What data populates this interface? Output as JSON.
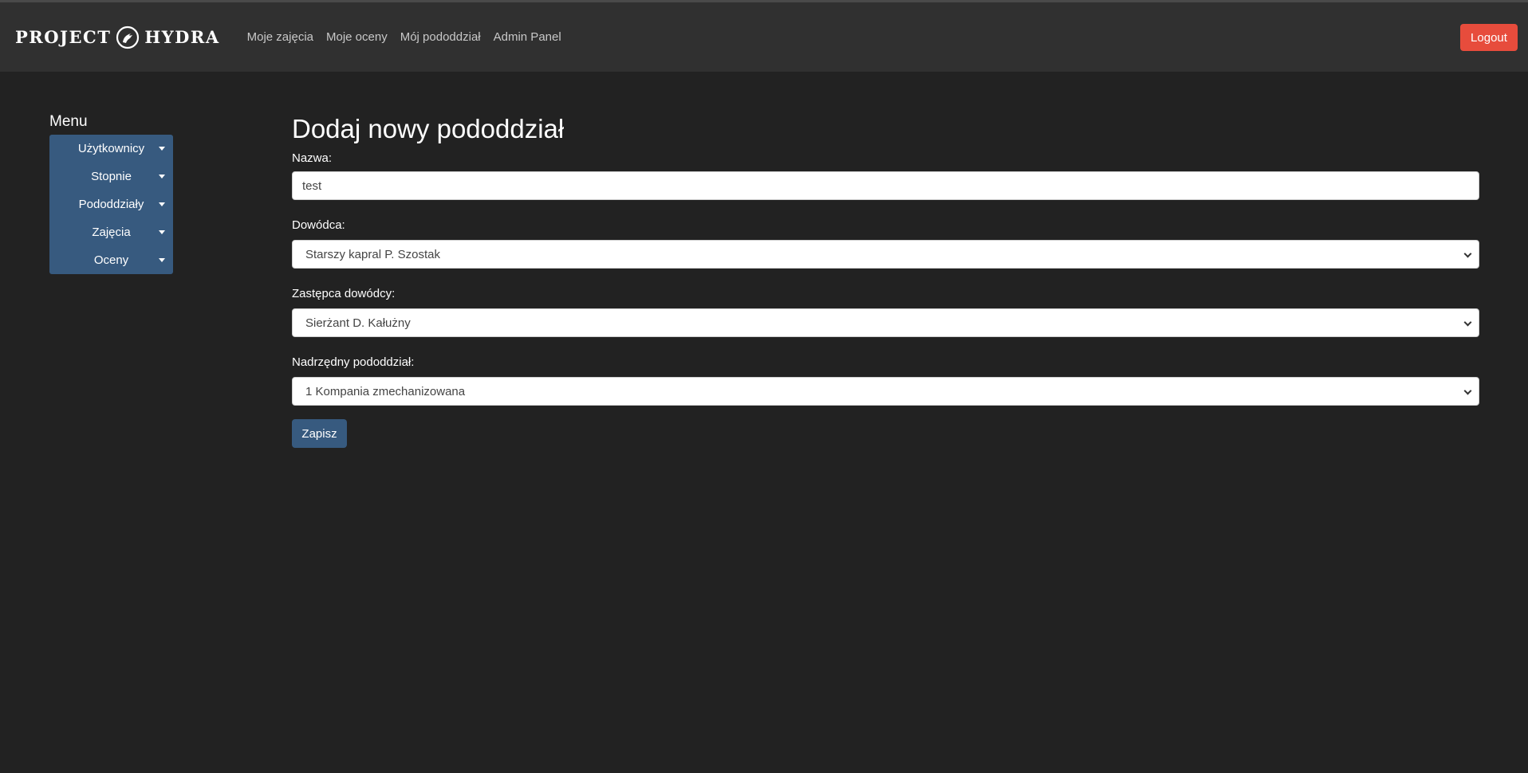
{
  "navbar": {
    "brand_left": "PROJECT",
    "brand_right": "HYDRA",
    "links": [
      "Moje zajęcia",
      "Moje oceny",
      "Mój pododdział",
      "Admin Panel"
    ],
    "logout_label": "Logout"
  },
  "sidebar": {
    "title": "Menu",
    "items": [
      {
        "label": "Użytkownicy"
      },
      {
        "label": "Stopnie"
      },
      {
        "label": "Pododdziały"
      },
      {
        "label": "Zajęcia"
      },
      {
        "label": "Oceny"
      }
    ]
  },
  "form": {
    "title": "Dodaj nowy pododdział",
    "name_label": "Nazwa:",
    "name_value": "test",
    "commander_label": "Dowódca:",
    "commander_value": "Starszy kapral P. Szostak",
    "deputy_label": "Zastępca dowódcy:",
    "deputy_value": "Sierżant D. Kałużny",
    "parent_label": "Nadrzędny pododdział:",
    "parent_value": "1 Kompania zmechanizowana",
    "save_label": "Zapisz"
  },
  "colors": {
    "background": "#222222",
    "navbar": "#303030",
    "primary": "#375a7f",
    "danger": "#e74c3c"
  },
  "icons": {
    "logo": "hydra-logo-icon",
    "dropdown": "caret-down-icon",
    "select": "chevron-down-icon"
  }
}
